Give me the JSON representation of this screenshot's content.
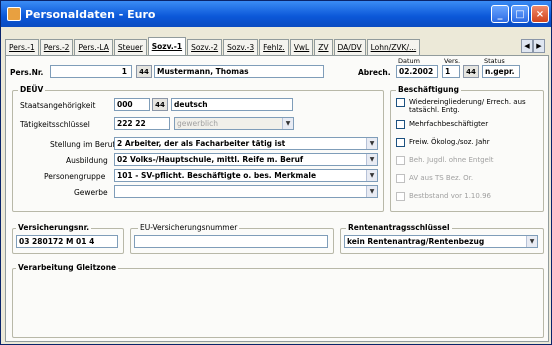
{
  "window": {
    "title": "Personaldaten - Euro",
    "buttons": {
      "min": "_",
      "max": "□",
      "close": "×"
    }
  },
  "tabs": [
    "Pers.-1",
    "Pers.-2",
    "Pers.-LA",
    "Steuer",
    "Sozv.-1",
    "Sozv.-2",
    "Sozv.-3",
    "Fehlz.",
    "VwL",
    "ZV",
    "DA/DV",
    "Lohn/ZVK/..."
  ],
  "scroll": {
    "left": "◀",
    "right": "▶"
  },
  "header": {
    "persnr_label": "Pers.Nr.",
    "persnr_value": "1",
    "search": "44",
    "name_value": "Mustermann, Thomas",
    "abrech_label": "Abrech.",
    "datum_label": "Datum",
    "datum_value": "02.2002",
    "vers_label": "Vers.",
    "vers_value": "1",
    "status_label": "Status",
    "status_value": "n.gepr."
  },
  "deuev": {
    "title": "DEÜV",
    "staatsang_label": "Staatsangehörigkeit",
    "staatsang_code": "000",
    "staatsang_search": "44",
    "staatsang_text": "deutsch",
    "taetig_label": "Tätigkeitsschlüssel",
    "taetig_code": "222 22",
    "taetig_placeholder": "gewerblich",
    "stellung_label": "Stellung im Beruf",
    "stellung_value": "2 Arbeiter, der als Facharbeiter tätig ist",
    "ausbildung_label": "Ausbildung",
    "ausbildung_value": "02 Volks-/Hauptschule, mittl. Reife m. Beruf",
    "personengruppe_label": "Personengruppe",
    "personengruppe_value": "101 - SV-pflicht. Beschäftigte o. bes. Merkmale",
    "gewerbe_label": "Gewerbe",
    "gewerbe_value": ""
  },
  "beschaeftigung": {
    "title": "Beschäftigung",
    "items": [
      {
        "label": "Wiedereingliederung/ Errech. aus tatsächl. Entg.",
        "enabled": true
      },
      {
        "label": "Mehrfachbeschäftigter",
        "enabled": true
      },
      {
        "label": "Freiw. Ökolog./soz. Jahr",
        "enabled": true
      },
      {
        "label": "Beh. Jugdl. ohne Entgelt",
        "enabled": false
      },
      {
        "label": "AV aus TS Bez. Or.",
        "enabled": false
      },
      {
        "label": "Bestbstand vor 1.10.96",
        "enabled": false
      }
    ]
  },
  "versicherung": {
    "vnr_title": "Versicherungsnr.",
    "vnr_value": "03 280172 M 01 4",
    "eu_title": "EU-Versicherungsnummer",
    "eu_value": "",
    "renten_title": "Rentenantragsschlüssel",
    "renten_value": "kein Rentenantrag/Rentenbezug"
  },
  "gleitzone": {
    "title": "Verarbeitung Gleitzone"
  }
}
